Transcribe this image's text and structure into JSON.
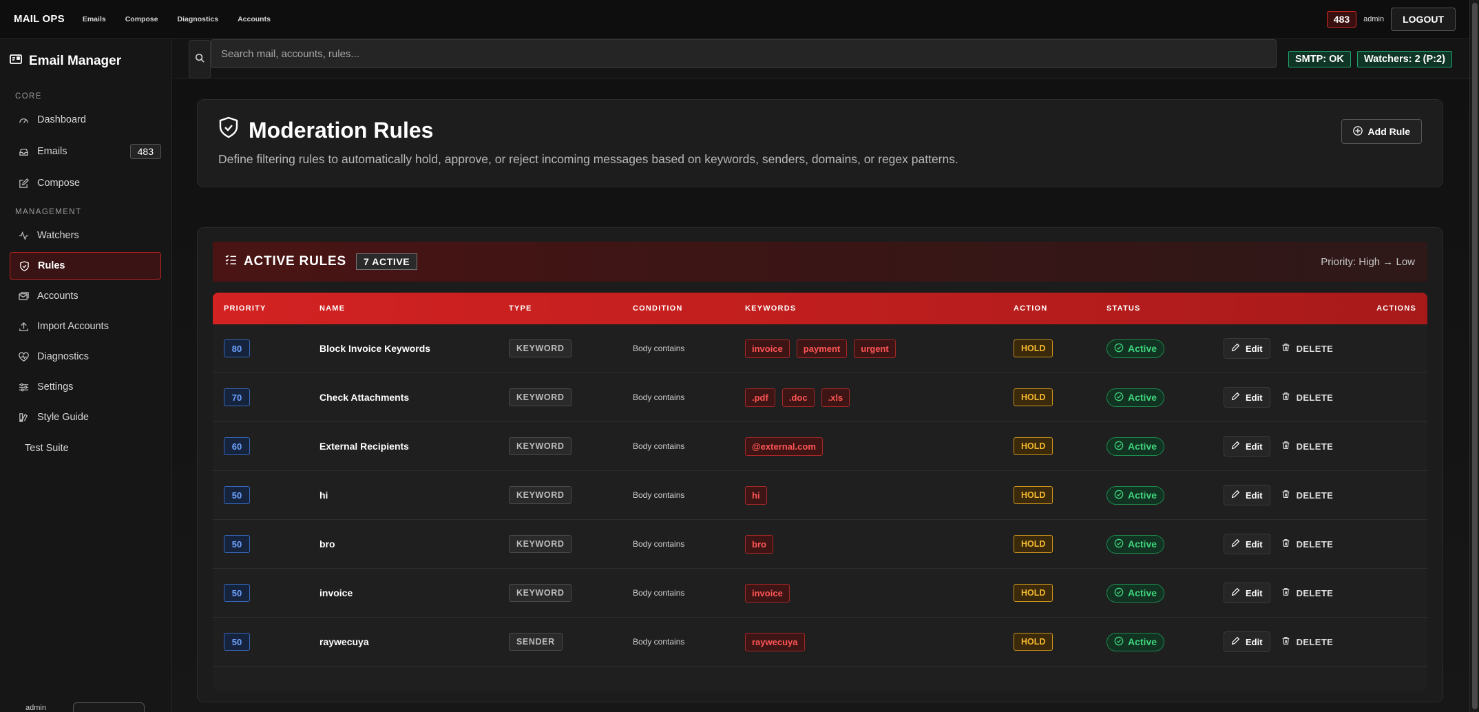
{
  "topnav": {
    "brand": "MAIL OPS",
    "links": [
      "Emails",
      "Compose",
      "Diagnostics",
      "Accounts"
    ],
    "count_badge": "483",
    "user": "admin",
    "logout_label": "LOGOUT"
  },
  "sidebar": {
    "title": "Email Manager",
    "section_core": "CORE",
    "section_management": "MANAGEMENT",
    "items": [
      {
        "label": "Dashboard",
        "icon": "gauge-icon"
      },
      {
        "label": "Emails",
        "icon": "inbox-icon",
        "badge": "483"
      },
      {
        "label": "Compose",
        "icon": "pencil-square-icon"
      },
      {
        "label": "Watchers",
        "icon": "activity-icon"
      },
      {
        "label": "Rules",
        "icon": "shield-icon",
        "active": true
      },
      {
        "label": "Accounts",
        "icon": "envelope-stack-icon"
      },
      {
        "label": "Import Accounts",
        "icon": "upload-icon"
      },
      {
        "label": "Diagnostics",
        "icon": "heart-pulse-icon"
      },
      {
        "label": "Settings",
        "icon": "sliders-icon"
      },
      {
        "label": "Style Guide",
        "icon": "palette-icon"
      },
      {
        "label": "Test Suite",
        "icon": ""
      }
    ],
    "footer_user": "admin"
  },
  "search": {
    "placeholder": "Search mail, accounts, rules...",
    "smtp_status": "SMTP: OK",
    "watchers_status": "Watchers: 2 (P:2)"
  },
  "page": {
    "title": "Moderation Rules",
    "subtitle": "Define filtering rules to automatically hold, approve, or reject incoming messages based on keywords, senders, domains, or regex patterns.",
    "add_rule_label": "Add Rule"
  },
  "rules": {
    "heading": "ACTIVE RULES",
    "active_count": "7 ACTIVE",
    "priority_hint": "Priority: High → Low",
    "columns": [
      "PRIORITY",
      "NAME",
      "TYPE",
      "CONDITION",
      "KEYWORDS",
      "ACTION",
      "STATUS",
      "ACTIONS"
    ],
    "edit_label": "Edit",
    "delete_label": "DELETE",
    "rows": [
      {
        "priority": "80",
        "name": "Block Invoice Keywords",
        "type": "KEYWORD",
        "condition": "Body contains",
        "keywords": [
          "invoice",
          "payment",
          "urgent"
        ],
        "action": "HOLD",
        "status": "Active"
      },
      {
        "priority": "70",
        "name": "Check Attachments",
        "type": "KEYWORD",
        "condition": "Body contains",
        "keywords": [
          ".pdf",
          ".doc",
          ".xls"
        ],
        "action": "HOLD",
        "status": "Active"
      },
      {
        "priority": "60",
        "name": "External Recipients",
        "type": "KEYWORD",
        "condition": "Body contains",
        "keywords": [
          "@external.com"
        ],
        "action": "HOLD",
        "status": "Active"
      },
      {
        "priority": "50",
        "name": "hi",
        "type": "KEYWORD",
        "condition": "Body contains",
        "keywords": [
          "hi"
        ],
        "action": "HOLD",
        "status": "Active"
      },
      {
        "priority": "50",
        "name": "bro",
        "type": "KEYWORD",
        "condition": "Body contains",
        "keywords": [
          "bro"
        ],
        "action": "HOLD",
        "status": "Active"
      },
      {
        "priority": "50",
        "name": "invoice",
        "type": "KEYWORD",
        "condition": "Body contains",
        "keywords": [
          "invoice"
        ],
        "action": "HOLD",
        "status": "Active"
      },
      {
        "priority": "50",
        "name": "raywecuya",
        "type": "SENDER",
        "condition": "Body contains",
        "keywords": [
          "raywecuya"
        ],
        "action": "HOLD",
        "status": "Active"
      }
    ]
  }
}
